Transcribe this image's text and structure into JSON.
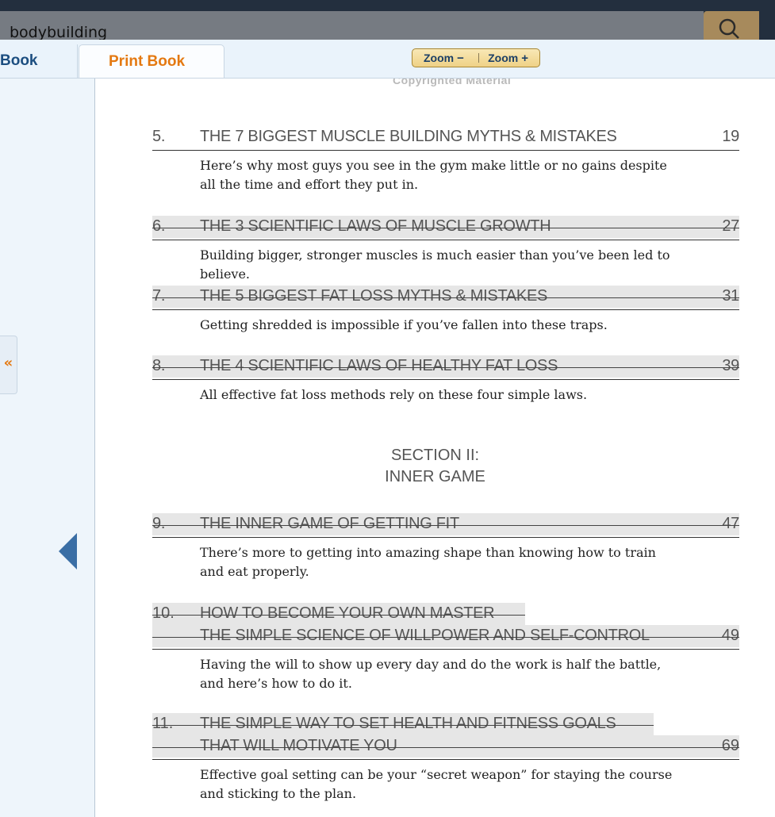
{
  "search": {
    "value": "bodybuilding"
  },
  "tabs": {
    "kindle": "Book",
    "print": "Print Book"
  },
  "zoom": {
    "out_label": "Zoom",
    "in_label": "Zoom",
    "out_sign": "−",
    "in_sign": "+"
  },
  "sidebar": {
    "collapse_glyph": "«"
  },
  "page": {
    "copyright": "Copyrighted Material",
    "entries": [
      {
        "num": "5.",
        "title": "THE 7 BIGGEST MUSCLE BUILDING MYTHS & MISTAKES",
        "page": "19",
        "desc": "Here’s why most guys you see in the gym make little or no gains despite all the time and effort they put in."
      },
      {
        "num": "6.",
        "title": "THE 3 SCIENTIFIC LAWS OF MUSCLE GROWTH",
        "page": "27",
        "desc": "Building bigger, stronger muscles is much easier than you’ve been led to believe."
      },
      {
        "num": "7.",
        "title": "THE 5 BIGGEST FAT LOSS MYTHS & MISTAKES",
        "page": "31",
        "desc": "Getting shredded is impossible if you’ve fallen into these traps."
      },
      {
        "num": "8.",
        "title": "THE 4 SCIENTIFIC LAWS OF HEALTHY FAT LOSS",
        "page": "39",
        "desc": "All effective fat loss methods rely on these four simple laws."
      },
      {
        "num": "9.",
        "title": "THE INNER GAME OF GETTING FIT",
        "page": "47",
        "desc": "There’s more to getting into amazing shape than knowing how to train and eat properly."
      },
      {
        "num": "10.",
        "title_line1": "HOW TO BECOME YOUR OWN MASTER",
        "title_line2": "THE SIMPLE SCIENCE OF WILLPOWER AND SELF-CONTROL",
        "page": "49",
        "desc": "Having the will to show up every day and do the work is half the battle, and here’s how to do it."
      },
      {
        "num": "11.",
        "title_line1": "THE SIMPLE WAY TO SET HEALTH AND FITNESS GOALS",
        "title_line2": "THAT WILL MOTIVATE YOU",
        "page": "69",
        "desc": "Effective goal setting can be your “secret weapon” for staying the course and sticking to the plan."
      }
    ],
    "section": {
      "line1": "SECTION II:",
      "line2": "INNER GAME"
    }
  }
}
